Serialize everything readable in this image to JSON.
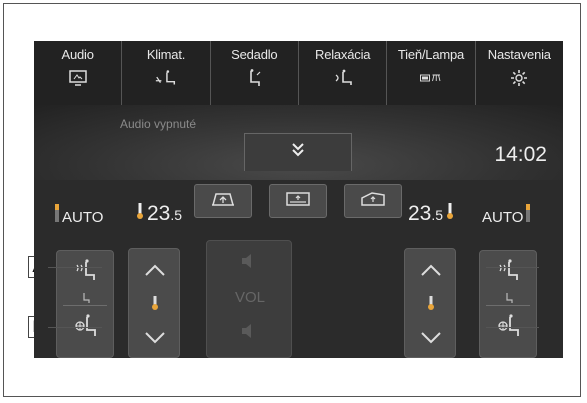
{
  "menu": {
    "items": [
      {
        "label": "Audio",
        "icon": "screen-icon"
      },
      {
        "label": "Klimat.",
        "icon": "climate-seat-icon"
      },
      {
        "label": "Sedadlo",
        "icon": "seat-icon"
      },
      {
        "label": "Relaxácia",
        "icon": "relax-seat-icon"
      },
      {
        "label": "Tieň/Lampa",
        "icon": "shade-lamp-icon"
      },
      {
        "label": "Nastavenia",
        "icon": "gear-icon"
      }
    ]
  },
  "status": {
    "audio_off": "Audio vypnuté",
    "clock": "14:02"
  },
  "climate": {
    "left": {
      "auto": "AUTO",
      "temp_int": "23",
      "temp_dec": ".5"
    },
    "right": {
      "auto": "AUTO",
      "temp_int": "23",
      "temp_dec": ".5"
    },
    "volume_label": "VOL"
  },
  "callouts": {
    "a": "A",
    "b": "B"
  },
  "colors": {
    "indicator": "#e9a53a",
    "screen_bg": "#2b2b2b"
  }
}
